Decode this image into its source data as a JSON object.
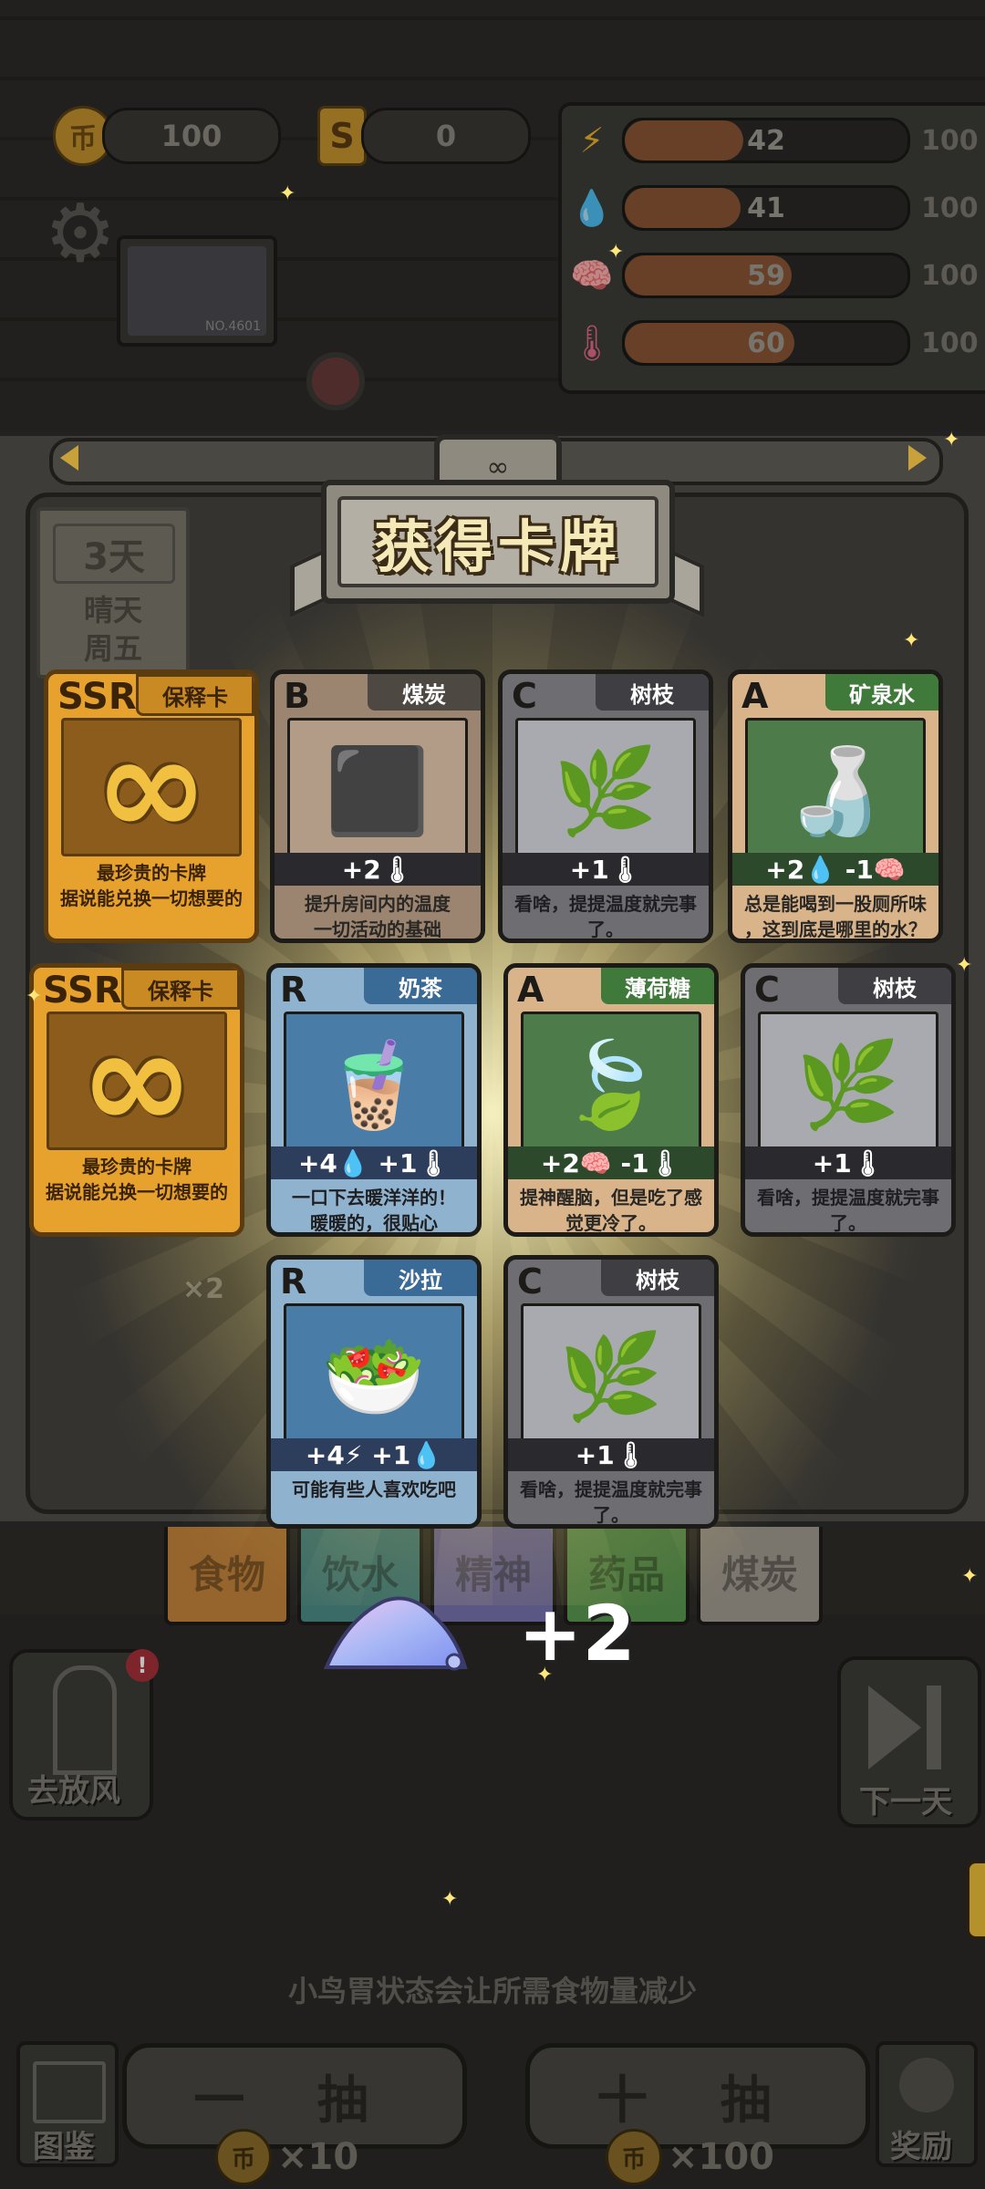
{
  "hud": {
    "coins": "100",
    "gold": "0",
    "coin_icon": "币",
    "gold_icon": "S",
    "monitor_label": "NO.4601",
    "stats": [
      {
        "icon": "energy-icon",
        "glyph": "⚡",
        "value": "42",
        "max": "100",
        "percent": 42,
        "color": "#f0b32e"
      },
      {
        "icon": "water-icon",
        "glyph": "💧",
        "value": "41",
        "max": "100",
        "percent": 41,
        "color": "#5fb8e8"
      },
      {
        "icon": "brain-icon",
        "glyph": "🧠",
        "value": "59",
        "max": "100",
        "percent": 59,
        "color": "#8f7de0"
      },
      {
        "icon": "thermometer-icon",
        "glyph": "🌡",
        "value": "60",
        "max": "100",
        "percent": 60,
        "color": "#e56b87"
      }
    ]
  },
  "day_card": {
    "day": "3天",
    "weather": "晴天",
    "weekday": "周五"
  },
  "dialog": {
    "title": "获得卡牌",
    "plaque_symbol": "∞"
  },
  "cards": [
    {
      "rank": "SSR",
      "name": "保释卡",
      "desc": "最珍贵的卡牌\n据说能兑换一切想要的",
      "effect": ""
    },
    {
      "rank": "B",
      "name": "煤炭",
      "effect": "+2🌡",
      "desc": "提升房间内的温度\n一切活动的基础"
    },
    {
      "rank": "C",
      "name": "树枝",
      "effect": "+1🌡",
      "desc": "看啥，提提温度就完事\n了。"
    },
    {
      "rank": "A",
      "name": "矿泉水",
      "effect": "+2💧 -1🧠",
      "desc": "总是能喝到一股厕所味\n，这到底是哪里的水？"
    },
    {
      "rank": "SSR",
      "name": "保释卡",
      "desc": "最珍贵的卡牌\n据说能兑换一切想要的",
      "effect": ""
    },
    {
      "rank": "R",
      "name": "奶茶",
      "effect": "+4💧 +1🌡",
      "desc": "一口下去暖洋洋的！\n暖暖的，很贴心"
    },
    {
      "rank": "A",
      "name": "薄荷糖",
      "effect": "+2🧠 -1🌡",
      "desc": "提神醒脑，但是吃了感\n觉更冷了。"
    },
    {
      "rank": "C",
      "name": "树枝",
      "effect": "+1🌡",
      "desc": "看啥，提提温度就完事\n了。"
    },
    {
      "rank": "R",
      "name": "沙拉",
      "effect": "+4⚡ +1💧",
      "desc": "可能有些人喜欢吃吧"
    },
    {
      "rank": "C",
      "name": "树枝",
      "effect": "+1🌡",
      "desc": "看啥，提提温度就完事\n了。"
    }
  ],
  "tabs": [
    "食物",
    "饮水",
    "精神",
    "药品",
    "煤炭"
  ],
  "reward": {
    "amount": "+2"
  },
  "behind_text": {
    "qty1": "+2",
    "qty2": "×2"
  },
  "buttons": {
    "vent": "去放风",
    "next_day": "下一天",
    "draw_one": "一 抽",
    "draw_ten": "十 抽",
    "cost_one": "×10",
    "cost_ten": "×100",
    "codex": "图鉴",
    "reward": "奖励"
  },
  "hint": "小鸟胃状态会让所需食物量减少"
}
